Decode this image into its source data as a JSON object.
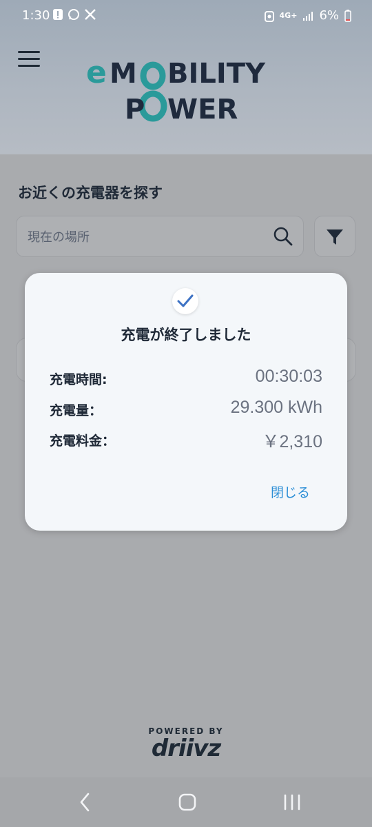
{
  "status_bar": {
    "time": "1:30",
    "battery": "6%",
    "network": "4G+"
  },
  "header": {
    "logo_line1_a": "e",
    "logo_line1_b": "M",
    "logo_line1_c": "BILITY",
    "logo_line2_a": "P",
    "logo_line2_b": "WER"
  },
  "search_section": {
    "title": "お近くの充電器を探す",
    "placeholder": "現在の場所"
  },
  "modal": {
    "title": "充電が終了しました",
    "rows": [
      {
        "label": "充電時間:",
        "value": "00:30:03"
      },
      {
        "label": "充電量：",
        "value": "29.300 kWh"
      },
      {
        "label": "充電料金：",
        "value": "￥2,310"
      }
    ],
    "close_label": "閉じる"
  },
  "footer": {
    "powered_by": "POWERED BY",
    "brand": "driivz"
  },
  "colors": {
    "accent": "#2b8ed6",
    "logo_teal": "#2a9a9a",
    "logo_navy": "#1f2a3d"
  }
}
